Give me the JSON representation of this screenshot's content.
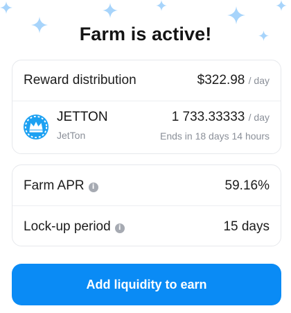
{
  "title": "Farm is active!",
  "reward": {
    "label": "Reward distribution",
    "amount": "$322.98",
    "unit": "/ day"
  },
  "token": {
    "symbol": "JETTON",
    "name": "JetTon",
    "amount": "1 733.33333",
    "unit": "/ day",
    "ends": "Ends in 18 days 14 hours",
    "icon": "crown-logo-icon"
  },
  "stats": {
    "apr_label": "Farm APR",
    "apr_value": "59.16%",
    "lockup_label": "Lock-up period",
    "lockup_value": "15 days"
  },
  "button": {
    "label": "Add liquidity to earn"
  },
  "colors": {
    "accent": "#0a8bf5",
    "sparkle": "#a7d4fb",
    "token_bg": "#1da1f2"
  }
}
